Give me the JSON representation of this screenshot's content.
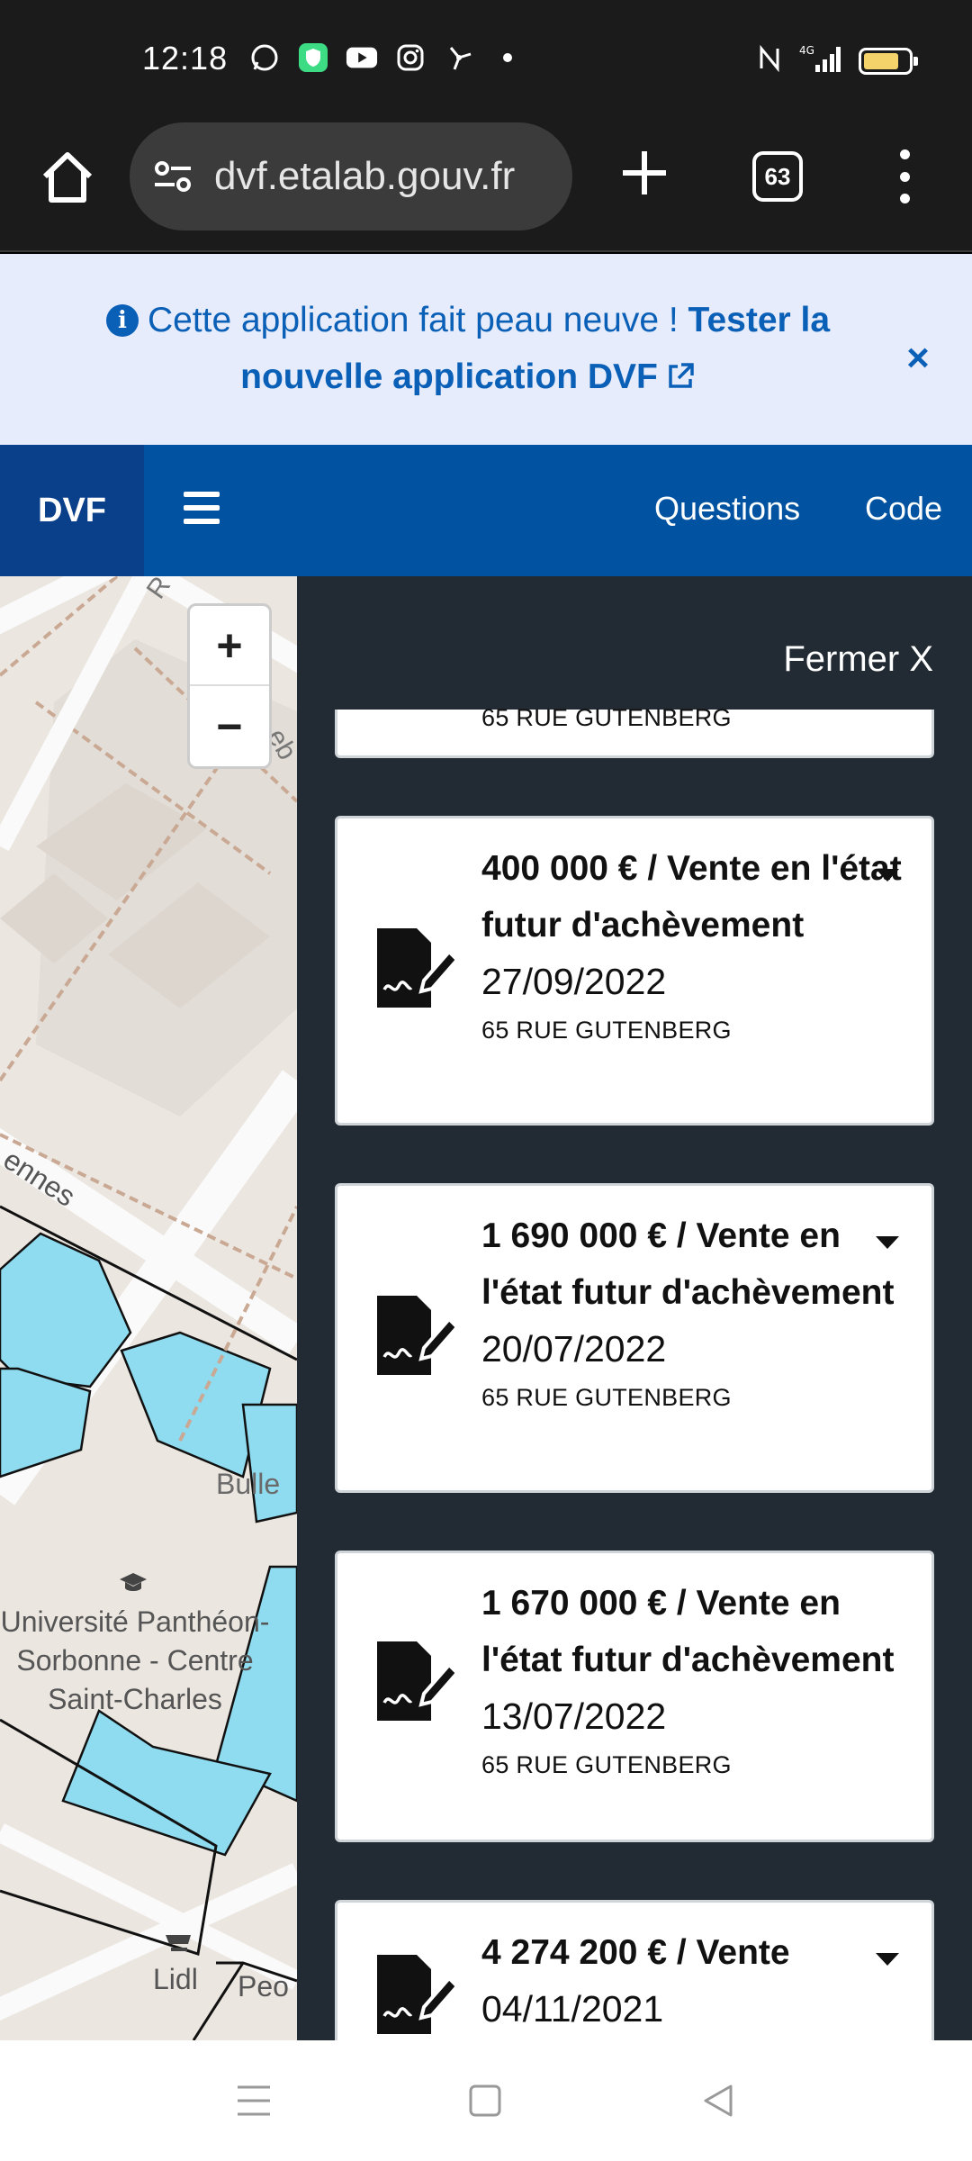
{
  "status_bar": {
    "time": "12:18",
    "notification_icons": [
      "whatsapp-icon",
      "vpn-shield-icon",
      "youtube-icon",
      "instagram-icon",
      "fan-icon",
      "dot-icon"
    ],
    "right_icons": [
      "nfc-icon",
      "signal-4g-icon",
      "battery-icon"
    ],
    "network": "4G"
  },
  "browser": {
    "url": "dvf.etalab.gouv.fr",
    "tab_count": "63"
  },
  "banner": {
    "text": "Cette application fait peau neuve !",
    "link_text": "Tester la nouvelle application DVF",
    "close": "×"
  },
  "nav": {
    "brand": "DVF",
    "links": [
      "Questions",
      "Code"
    ]
  },
  "map": {
    "zoom_in": "+",
    "zoom_out": "−",
    "labels": {
      "street_top": "R",
      "street_right": "eb",
      "rennes": "ennes",
      "bulle": "Bulle",
      "univ_line1": "Université Panthéon-",
      "univ_line2": "Sorbonne - Centre",
      "univ_line3": "Saint-Charles",
      "lidl": "Lidl",
      "peo": "Peo"
    }
  },
  "panel": {
    "close_label": "Fermer X",
    "partial_address": "65 RUE GUTENBERG",
    "sales": [
      {
        "title": "400 000 € / Vente en l'état futur d'achèvement",
        "date": "27/09/2022",
        "address": "65 RUE GUTENBERG"
      },
      {
        "title": "1 690 000 € / Vente en l'état futur d'achèvement",
        "date": "20/07/2022",
        "address": "65 RUE GUTENBERG"
      },
      {
        "title": "1 670 000 € / Vente en l'état futur d'achèvement",
        "date": "13/07/2022",
        "address": "65 RUE GUTENBERG"
      },
      {
        "title": "4 274 200 € / Vente",
        "date": "04/11/2021",
        "address": ""
      }
    ]
  },
  "colors": {
    "banner_bg": "#e6ecfb",
    "banner_text": "#0a5fb7",
    "nav_bg": "#0153a1",
    "brand_bg": "#0a3f8a",
    "panel_bg": "#222b33",
    "parcel_blue": "#8fdbef"
  }
}
